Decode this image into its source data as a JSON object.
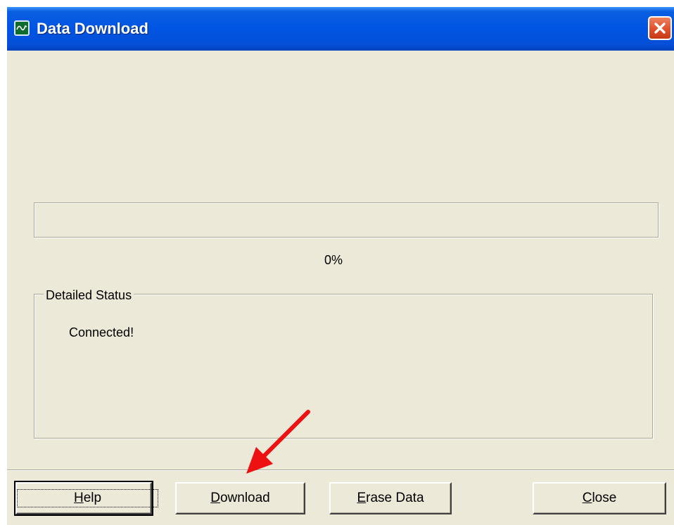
{
  "window": {
    "title": "Data Download",
    "icon": "chart-monitor-icon",
    "close_icon": "close-x-icon"
  },
  "progress": {
    "value": 0,
    "label": "0%"
  },
  "status_group": {
    "label": "Detailed Status",
    "message": "Connected!"
  },
  "buttons": {
    "help": {
      "mnemonic": "H",
      "rest": "elp"
    },
    "download": {
      "mnemonic": "D",
      "rest": "ownload"
    },
    "erase": {
      "mnemonic": "E",
      "rest": "rase Data"
    },
    "close": {
      "mnemonic": "C",
      "rest": "lose"
    }
  },
  "annotation": {
    "arrow_color": "#ee1111",
    "points_to": "download-button"
  },
  "colors": {
    "titlebar": "#0054e3",
    "face": "#ece9d8",
    "close_button": "#e0502a"
  }
}
